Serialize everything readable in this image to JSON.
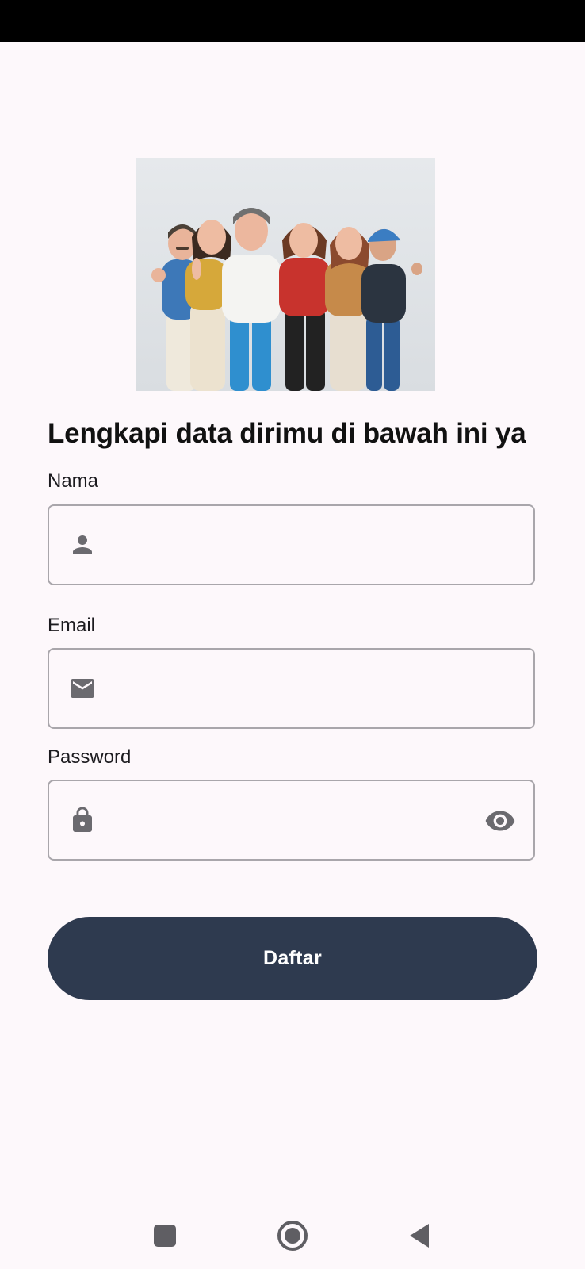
{
  "form": {
    "title": "Lengkapi data dirimu di bawah ini ya",
    "fields": {
      "name": {
        "label": "Nama",
        "value": "",
        "icon": "person-icon"
      },
      "email": {
        "label": "Email",
        "value": "",
        "icon": "mail-icon"
      },
      "password": {
        "label": "Password",
        "value": "",
        "icon": "lock-icon",
        "trailing_icon": "eye-icon"
      }
    },
    "submit_label": "Daftar"
  },
  "colors": {
    "background": "#fdf8fb",
    "primary_button": "#2e3a4f",
    "field_border": "#a9a6ab",
    "icon": "#6b6a6f"
  },
  "nav_bar": {
    "items": [
      "recents-icon",
      "home-icon",
      "back-icon"
    ]
  }
}
